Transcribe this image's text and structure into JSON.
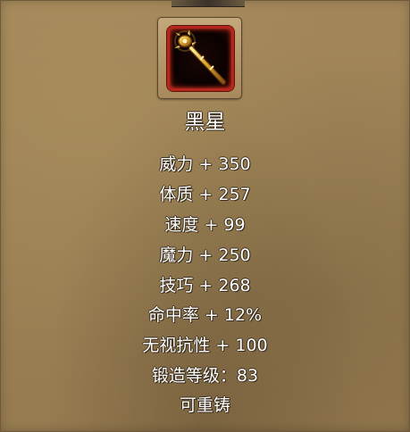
{
  "item": {
    "icon": "golden-staff-icon",
    "name": "黑星"
  },
  "stats": [
    {
      "label": "威力 + 350"
    },
    {
      "label": "体质 + 257"
    },
    {
      "label": "速度 + 99"
    },
    {
      "label": "魔力 + 250"
    },
    {
      "label": "技巧 + 268"
    },
    {
      "label": "命中率 + 12%"
    },
    {
      "label": "无视抗性 + 100"
    },
    {
      "label": "锻造等级：83"
    },
    {
      "label": "可重铸"
    }
  ],
  "colors": {
    "parchment": "#9c8256",
    "slot_border": "#b5271c",
    "text": "#ffffff"
  }
}
